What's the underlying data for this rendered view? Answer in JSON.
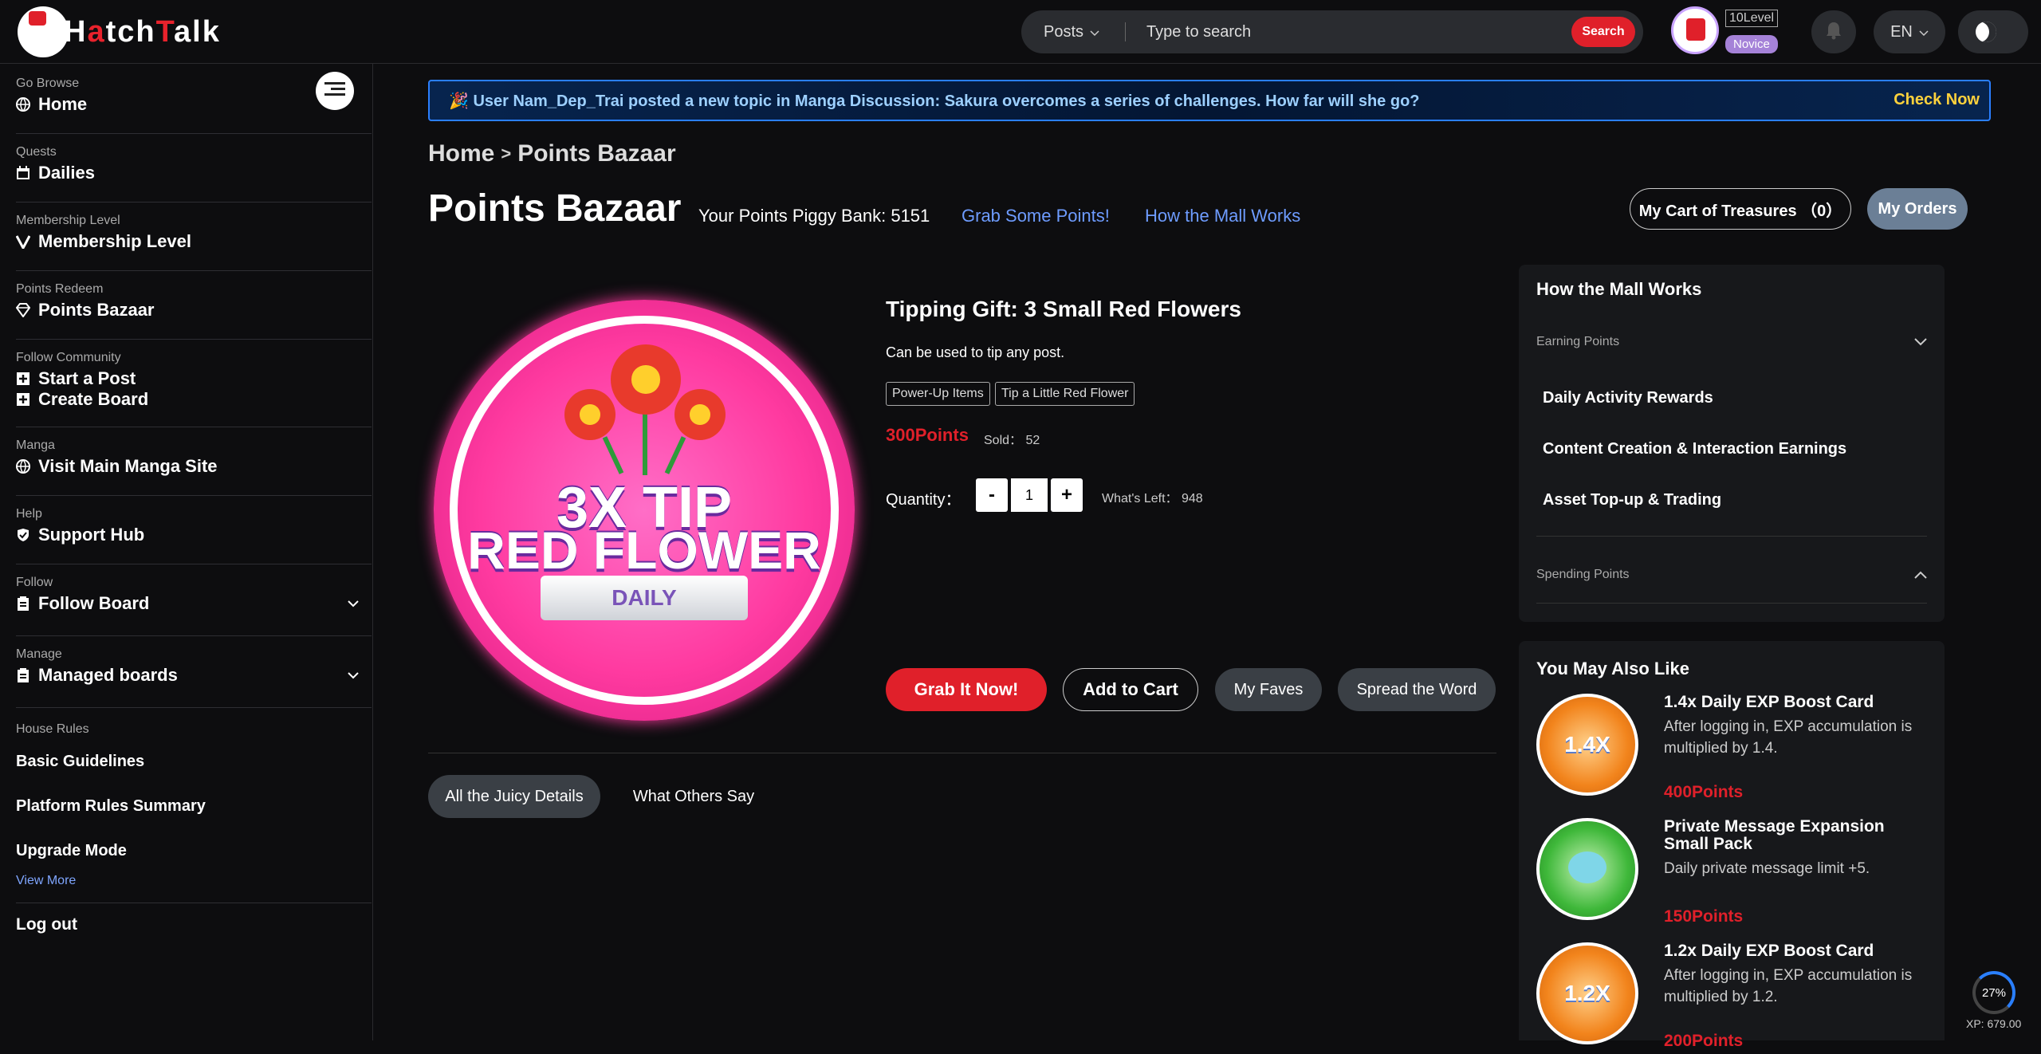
{
  "header": {
    "logo_text_pre": "H",
    "logo_text_red1": "a",
    "logo_text_mid": "tch",
    "logo_text_red2": "T",
    "logo_text_post": "alk",
    "search": {
      "type_label": "Posts",
      "placeholder": "Type to search",
      "button_label": "Search"
    },
    "user": {
      "level": "10Level",
      "rank": "Novice"
    },
    "lang": "EN"
  },
  "sidebar": {
    "sections": [
      {
        "category": "Go Browse",
        "label": "Home",
        "icon": "globe-icon"
      },
      {
        "category": "Quests",
        "label": "Dailies",
        "icon": "calendar-icon"
      },
      {
        "category": "Membership Level",
        "label": "Membership Level",
        "icon": "v-icon"
      },
      {
        "category": "Points Redeem",
        "label": "Points Bazaar",
        "icon": "diamond-icon"
      },
      {
        "category": "Follow Community",
        "label": "Start a Post",
        "label2": "Create Board",
        "icon": "plus-icon"
      },
      {
        "category": "Manga",
        "label": "Visit Main Manga Site",
        "icon": "globe-icon"
      },
      {
        "category": "Help",
        "label": "Support Hub",
        "icon": "shield-icon"
      },
      {
        "category": "Follow",
        "label": "Follow Board",
        "icon": "clipboard-icon"
      },
      {
        "category": "Manage",
        "label": "Managed boards",
        "icon": "clipboard-icon"
      }
    ],
    "house_rules": {
      "category": "House Rules",
      "items": [
        "Basic Guidelines",
        "Platform Rules Summary",
        "Upgrade Mode"
      ],
      "more": "View More"
    },
    "logout": "Log out"
  },
  "ticker": {
    "text": "🎉 User Nam_Dep_Trai posted a new topic in Manga Discussion: Sakura overcomes a series of challenges. How far will she go?",
    "cta": "Check Now"
  },
  "breadcrumb": {
    "home": "Home",
    "sep": ">",
    "current": "Points Bazaar"
  },
  "page": {
    "title": "Points Bazaar",
    "piggy_bank": "Your Points Piggy Bank: 5151",
    "grab_points": "Grab Some Points!",
    "how_works": "How the Mall Works",
    "cart_label": "My Cart of Treasures （0）",
    "orders_label": "My Orders"
  },
  "product": {
    "image_line1": "3X TIP",
    "image_line2": "RED FLOWER",
    "image_ribbon": "DAILY",
    "title": "Tipping Gift: 3 Small Red Flowers",
    "description": "Can be used to tip any post.",
    "tags": [
      "Power-Up Items",
      "Tip a Little Red Flower"
    ],
    "price": "300Points",
    "sold_label": "Sold：",
    "sold": "52",
    "quantity_label": "Quantity：",
    "quantity": "1",
    "minus": "-",
    "plus": "+",
    "left_label": "What's Left：",
    "left": "948",
    "buttons": {
      "grab": "Grab It Now!",
      "add_cart": "Add to Cart",
      "faves": "My Faves",
      "spread": "Spread the Word"
    },
    "tabs": [
      "All the Juicy Details",
      "What Others Say"
    ]
  },
  "mall_panel": {
    "title": "How the Mall Works",
    "earning": "Earning Points",
    "earning_items": [
      "Daily Activity Rewards",
      "Content Creation & Interaction Earnings",
      "Asset Top-up & Trading"
    ],
    "spending": "Spending Points"
  },
  "recommend": {
    "title": "You May Also Like",
    "items": [
      {
        "name": "1.4x Daily EXP Boost Card",
        "desc": "After logging in, EXP accumulation is multiplied by 1.4.",
        "price": "400Points",
        "badge": "1.4X",
        "color": "#f2841c"
      },
      {
        "name": "Private Message Expansion Small Pack",
        "desc": "Daily private message limit +5.",
        "price": "150Points",
        "badge": "",
        "color": "#3fb83a"
      },
      {
        "name": "1.2x Daily EXP Boost Card",
        "desc": "After logging in, EXP accumulation is multiplied by 1.2.",
        "price": "200Points",
        "badge": "1.2X",
        "color": "#f2841c"
      }
    ]
  },
  "xp": {
    "percent": "27%",
    "label": "XP: 679.00"
  },
  "colors": {
    "accent_red": "#e0202a",
    "link_blue": "#6e9cff",
    "ticker_border": "#2a7fff"
  }
}
